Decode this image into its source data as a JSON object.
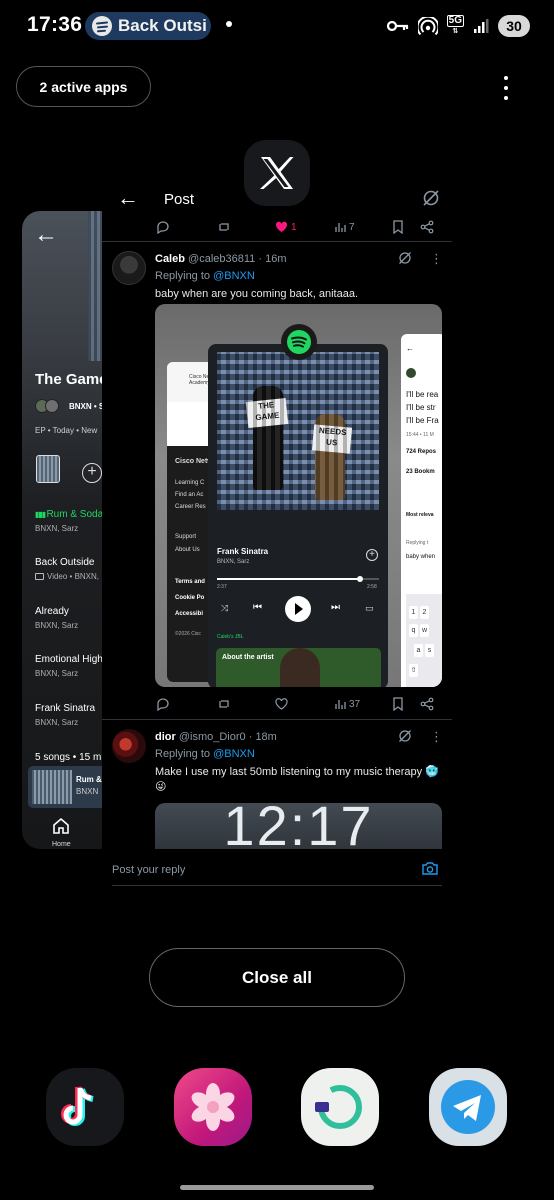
{
  "status_bar": {
    "time": "17:36",
    "media_pill_text": "Back Outsi",
    "network": "5G",
    "battery": "30"
  },
  "recents": {
    "active_apps_label": "2 active apps",
    "close_all_label": "Close all"
  },
  "spotify_card": {
    "album_title": "The Game",
    "artists_line": "BNXN • S",
    "meta_line": "EP • Today • New",
    "tracks": [
      {
        "title": "Rum & Soda",
        "artists": "BNXN, Sarz",
        "playing": true
      },
      {
        "title": "Back Outside",
        "artists": "Video • BNXN,"
      },
      {
        "title": "Already",
        "artists": "BNXN, Sarz"
      },
      {
        "title": "Emotional High",
        "artists": "BNXN, Sarz"
      },
      {
        "title": "Frank Sinatra",
        "artists": "BNXN, Sarz"
      }
    ],
    "summary": "5 songs • 15 min",
    "mini_player": {
      "title": "Rum &",
      "artist": "BNXN"
    },
    "home_label": "Home"
  },
  "x_card": {
    "header_title": "Post",
    "top_actions": {
      "likes": "1",
      "views": "7"
    },
    "posts": [
      {
        "name": "Caleb",
        "handle": "@caleb36811",
        "time": "16m",
        "replying_prefix": "Replying to",
        "replying_to": "@BNXN",
        "text": "baby when are you coming back, anitaaa.",
        "actions": {
          "views": "37"
        },
        "media": {
          "spotify": {
            "song": "Frank Sinatra",
            "artists": "BNXN, Sarz",
            "elapsed": "2:37",
            "duration": "2:58",
            "progress": 0.88,
            "device": "Caleb's JBL",
            "about": "About the artist",
            "sign1": "THE GAME",
            "sign2": "NEEDS US"
          },
          "cisco": {
            "brand": "Cisco Networking Academy",
            "nav": "Cisco Netw",
            "links": [
              "Learning C",
              "Find an Ac",
              "Career Res",
              "Support",
              "About Us",
              "Terms and",
              "Cookie Po",
              "Accessibi",
              "©2026 Cisc"
            ]
          },
          "tweet": {
            "lines": [
              "I'll be rea",
              "I'll be str",
              "I'll be Fra"
            ],
            "time": "15:44 • 11 M",
            "reposts": "724 Repos",
            "bookmarks": "23 Bookm",
            "most_relevant": "Most releva",
            "replying": "Replying t",
            "draft": "baby when"
          }
        }
      },
      {
        "name": "dior",
        "handle": "@ismo_Dior0",
        "time": "18m",
        "replying_prefix": "Replying to",
        "replying_to": "@BNXN",
        "text": "Make I use my last 50mb listening to my music therapy 🥶😜",
        "media_clock": "12:17"
      }
    ],
    "reply_placeholder": "Post your reply"
  },
  "dock": [
    {
      "name": "TikTok",
      "icon": "tiktok-icon",
      "bg": "#1a1a1a"
    },
    {
      "name": "Gallery",
      "icon": "gallery-flower-icon",
      "bg": "#e0226e"
    },
    {
      "name": "Opera",
      "icon": "ring-icon",
      "bg": "#e8ece9"
    },
    {
      "name": "Telegram",
      "icon": "paper-plane-icon",
      "bg": "#d6dde3"
    }
  ]
}
